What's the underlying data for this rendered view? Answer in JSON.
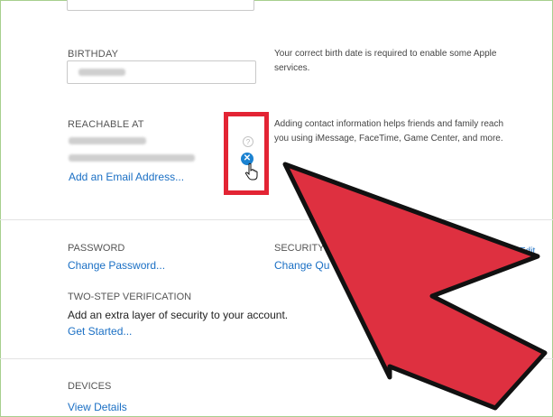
{
  "birthday": {
    "label": "BIRTHDAY",
    "description": "Your correct birth date is required to enable some Apple services."
  },
  "reachable": {
    "label": "REACHABLE AT",
    "description": "Adding contact information helps friends and family reach you using iMessage, FaceTime, Game Center, and more.",
    "add_email_link": "Add an Email Address...",
    "help_icon_glyph": "?",
    "remove_icon_glyph": "✕"
  },
  "password": {
    "label": "PASSWORD",
    "link": "Change Password..."
  },
  "security": {
    "label": "SECURITY",
    "link": "Change Qu",
    "edit": "Edit"
  },
  "two_step": {
    "label": "TWO-STEP VERIFICATION",
    "text": "Add an extra layer of security to your account.",
    "link": "Get Started..."
  },
  "devices": {
    "label": "DEVICES",
    "link": "View Details"
  },
  "colors": {
    "link": "#1a6fc4",
    "highlight": "#e32434",
    "arrow_fill": "#de3040",
    "remove_icon": "#1b82d1"
  }
}
